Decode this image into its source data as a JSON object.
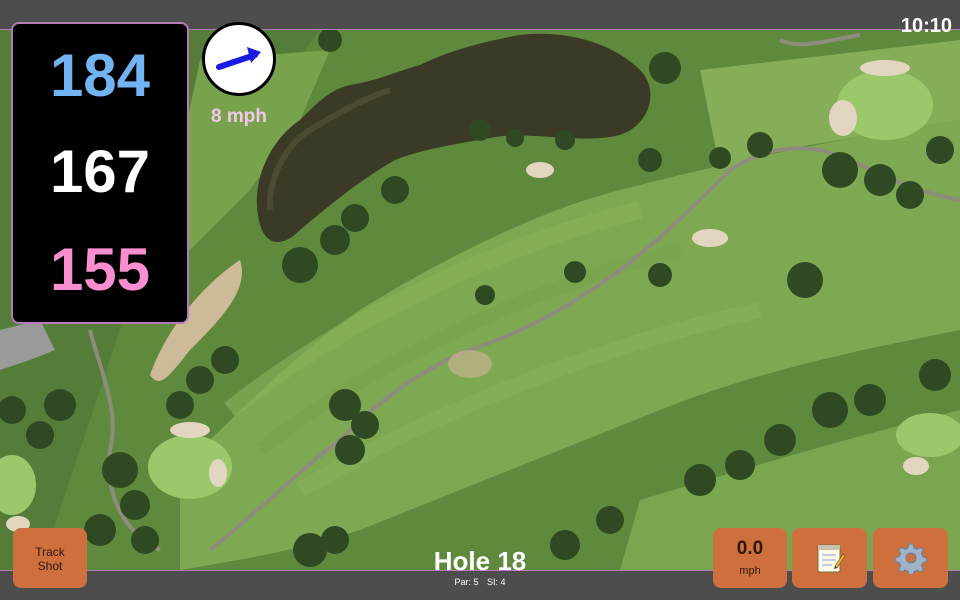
{
  "status": {
    "time": "10:10"
  },
  "distances": {
    "back": "184",
    "middle": "167",
    "front": "155"
  },
  "wind": {
    "speed": "8 mph",
    "icon": "wind-arrow-icon",
    "arrow_color": "#1a1ae6"
  },
  "hole": {
    "title": "Hole 18",
    "par_label": "Par: 5",
    "si_label": "SI: 4"
  },
  "buttons": {
    "track_shot_line1": "Track",
    "track_shot_line2": "Shot",
    "speed_value": "0.0",
    "speed_unit": "mph",
    "notes_icon": "notepad-icon",
    "settings_icon": "gear-icon"
  },
  "colors": {
    "accent_border": "#b57ab8",
    "button": "#cf6f3d",
    "back_distance": "#72b4f2",
    "middle_distance": "#ffffff",
    "front_distance": "#f98ed0"
  }
}
